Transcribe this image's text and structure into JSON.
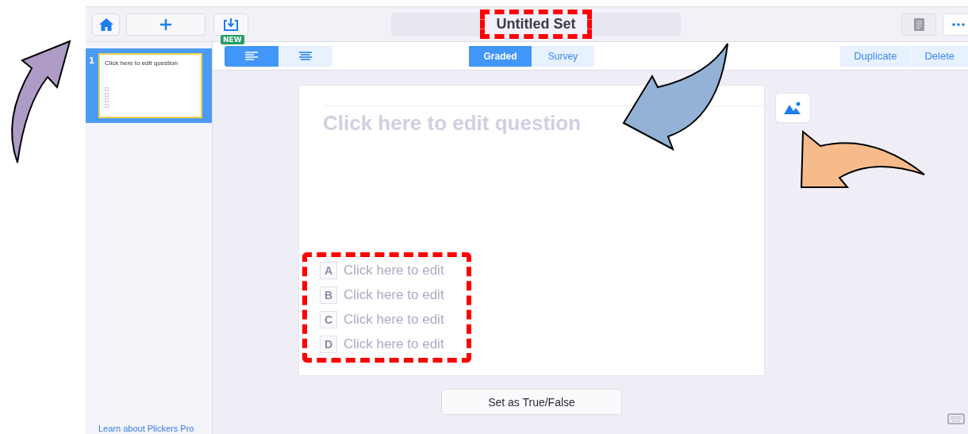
{
  "title": "Untitled Set",
  "new_badge": "NEW",
  "slides": [
    {
      "number": "1",
      "question": "Click here to edit question",
      "selected": true
    }
  ],
  "alignment_buttons": [
    {
      "kind": "left",
      "selected": true
    },
    {
      "kind": "center",
      "selected": false
    }
  ],
  "mode_tabs": [
    {
      "label": "Graded",
      "selected": true
    },
    {
      "label": "Survey",
      "selected": false
    }
  ],
  "actions": [
    "Duplicate",
    "Delete"
  ],
  "question": {
    "placeholder": "Click here to edit question"
  },
  "choices": [
    {
      "letter": "A",
      "placeholder": "Click here to edit"
    },
    {
      "letter": "B",
      "placeholder": "Click here to edit"
    },
    {
      "letter": "C",
      "placeholder": "Click here to edit"
    },
    {
      "letter": "D",
      "placeholder": "Click here to edit"
    }
  ],
  "true_false_button": "Set as True/False",
  "sidebar_link": "Learn about Plickers Pro"
}
